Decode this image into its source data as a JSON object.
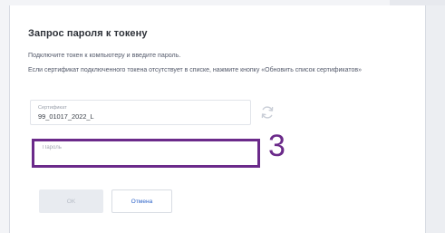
{
  "dialog": {
    "title": "Запрос пароля к токену",
    "instruction": "Подключите токен к компьютеру и введите пароль.",
    "note": "Если сертификат подключенного токена отсутствует в списке, нажмите кнопку «Обновить список сертификатов»"
  },
  "certificate": {
    "label": "Сертификат",
    "value": "99_01017_2022_L"
  },
  "password": {
    "placeholder": "Пароль",
    "value": ""
  },
  "annotation": {
    "number": "3",
    "color": "#6b2a8a"
  },
  "buttons": {
    "ok_label": "OK",
    "cancel_label": "Отмена"
  },
  "icons": {
    "refresh": "refresh-icon"
  },
  "colors": {
    "accent": "#2d63c8",
    "highlight": "#6b2a8a"
  }
}
